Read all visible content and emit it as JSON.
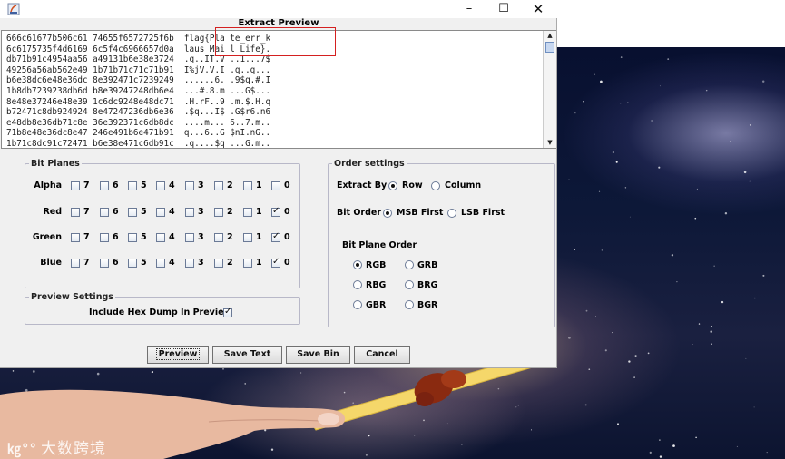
{
  "window": {
    "title": "Extract Preview",
    "controls": {
      "minimize": "–",
      "maximize": "☐",
      "close": "✕"
    }
  },
  "preview": {
    "lines": [
      "666c61677b506c61 74655f6572725f6b  flag{Pla te_err_k",
      "6c6175735f4d6169 6c5f4c6966657d0a  laus_Mai l_Life}.",
      "db71b91c4954aa56 a49131b6e38e3724  .q..IT.V ..1...7$",
      "49256a56ab562e49 1b71b71c71c71b91  I%jV.V.I .q..q...",
      "b6e38dc6e48e36dc 8e392471c7239249  ......6. .9$q.#.I",
      "1b8db7239238db6d b8e39247248db6e4  ...#.8.m ...G$...",
      "8e48e37246e48e39 1c6dc9248e48dc71  .H.rF..9 .m.$.H.q",
      "b72471c8db924924 8e47247236db6e36  .$q...I$ .G$r6.n6",
      "e48db8e36db71c8e 36e392371c6db8dc  ....m... 6..7.m..",
      "71b8e48e36dc8e47 246e491b6e471b91  q...6..G $nI.nG..",
      "1b71c8dc91c72471 b6e38e471c6db91c  .q....$q ...G.m.."
    ],
    "scrollbar": {
      "up": "▲",
      "down": "▼"
    }
  },
  "bit_planes": {
    "legend": "Bit Planes",
    "bits": [
      "7",
      "6",
      "5",
      "4",
      "3",
      "2",
      "1",
      "0"
    ],
    "rows": [
      {
        "label": "Alpha",
        "checked": []
      },
      {
        "label": "Red",
        "checked": [
          "0"
        ]
      },
      {
        "label": "Green",
        "checked": [
          "0"
        ]
      },
      {
        "label": "Blue",
        "checked": [
          "0"
        ]
      }
    ]
  },
  "order_settings": {
    "legend": "Order settings",
    "extract_by": {
      "label": "Extract By",
      "options": [
        "Row",
        "Column"
      ],
      "selected": "Row"
    },
    "bit_order": {
      "label": "Bit Order",
      "options": [
        "MSB First",
        "LSB First"
      ],
      "selected": "MSB First"
    },
    "bit_plane_order": {
      "label": "Bit Plane Order",
      "options": [
        "RGB",
        "GRB",
        "RBG",
        "BRG",
        "GBR",
        "BGR"
      ],
      "selected": "RGB"
    }
  },
  "preview_settings": {
    "legend": "Preview Settings",
    "hex_dump_label": "Include Hex Dump In Preview",
    "hex_dump_checked": true
  },
  "buttons": {
    "preview": "Preview",
    "save_text": "Save Text",
    "save_bin": "Save Bin",
    "cancel": "Cancel"
  },
  "watermark": {
    "logo": "㎏°°",
    "text": "大数跨境"
  }
}
